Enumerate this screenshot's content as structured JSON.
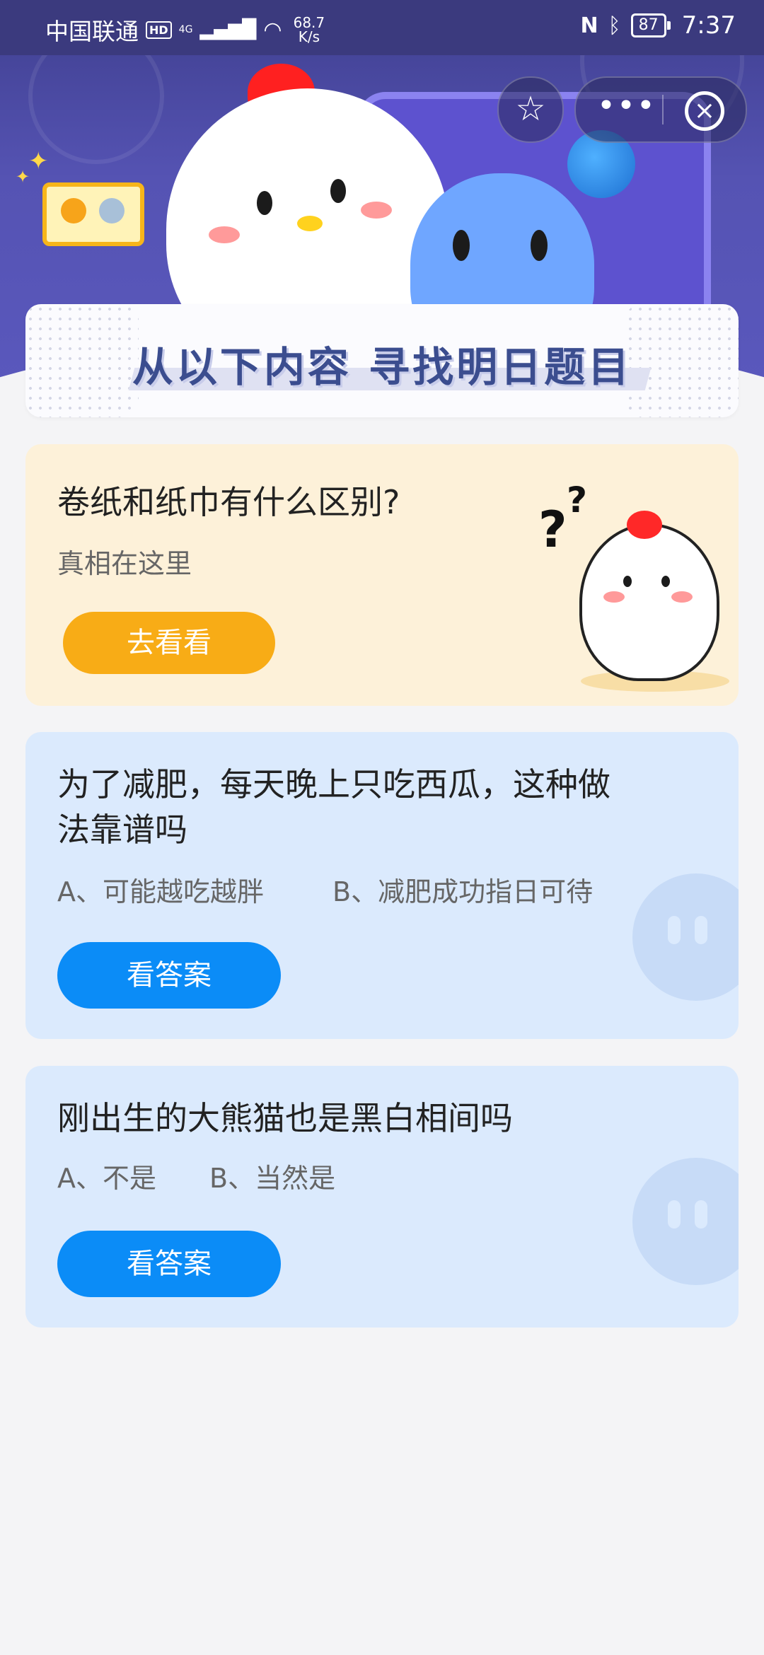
{
  "status_bar": {
    "carrier": "中国联通",
    "hd": "HD",
    "network": "4G",
    "speed_value": "68.7",
    "speed_unit": "K/s",
    "battery": "87",
    "time": "7:37"
  },
  "banner": {
    "title": "从以下内容 寻找明日题目"
  },
  "cards": [
    {
      "question": "卷纸和纸巾有什么区别?",
      "subtitle": "真相在这里",
      "button": "去看看"
    },
    {
      "question_line1": "为了减肥，每天晚上只吃西瓜，这种做",
      "question_line2": "法靠谱吗",
      "option_a": "A、可能越吃越胖",
      "option_b": "B、减肥成功指日可待",
      "button": "看答案"
    },
    {
      "question": "刚出生的大熊猫也是黑白相间吗",
      "option_a": "A、不是",
      "option_b": "B、当然是",
      "button": "看答案"
    }
  ],
  "colors": {
    "header": "#5553b3",
    "card_yellow": "#fdf1d9",
    "card_blue": "#dbeafd",
    "button_orange": "#f8ac16",
    "button_blue": "#0b8cf7"
  },
  "icons": [
    "star-icon",
    "more-icon",
    "close-icon",
    "wifi-icon",
    "bluetooth-icon",
    "nfc-icon"
  ]
}
